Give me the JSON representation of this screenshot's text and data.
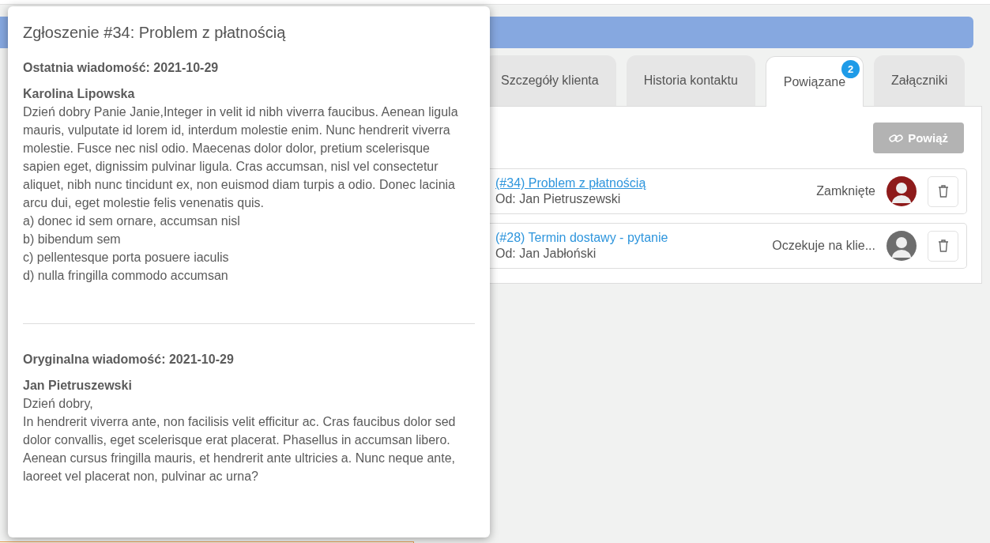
{
  "popover": {
    "title": "Zgłoszenie #34: Problem z płatnością",
    "sections": [
      {
        "heading": "Ostatnia wiadomość: 2021-10-29",
        "author": "Karolina Lipowska",
        "lines": [
          "Dzień dobry Panie Janie,Integer in velit id nibh viverra faucibus. Aenean ligula mauris, vulputate id lorem id, interdum molestie enim. Nunc hendrerit viverra molestie. Fusce nec nisl odio. Maecenas dolor dolor, pretium scelerisque sapien eget, dignissim pulvinar ligula. Cras accumsan, nisl vel consectetur aliquet, nibh nunc tincidunt ex, non euismod diam turpis a odio. Donec lacinia arcu dui, eget molestie felis venenatis quis.",
          "a) donec id sem ornare, accumsan nisl",
          "b) bibendum sem",
          "c) pellentesque porta posuere iaculis",
          "d) nulla fringilla commodo accumsan"
        ]
      },
      {
        "heading": "Oryginalna wiadomość: 2021-10-29",
        "author": "Jan Pietruszewski",
        "lines": [
          "Dzień dobry,",
          "In hendrerit viverra ante, non facilisis velit efficitur ac. Cras faucibus dolor sed dolor convallis, eget scelerisque erat placerat. Phasellus in accumsan libero.",
          "Aenean cursus fringilla mauris, et hendrerit ante ultricies a. Nunc neque ante, laoreet vel placerat non, pulvinar ac urna?"
        ]
      }
    ]
  },
  "tabs": [
    {
      "label": "Szczegóły klienta",
      "selected": false
    },
    {
      "label": "Historia kontaktu",
      "selected": false
    },
    {
      "label": "Powiązane",
      "selected": true,
      "badge": "2"
    },
    {
      "label": "Załączniki",
      "selected": false
    }
  ],
  "link_button": "Powiąż",
  "related": [
    {
      "title": "(#34) Problem z płatnością",
      "from": "Od: Jan Pietruszewski",
      "status": "Zamknięte",
      "color": "#8e1b1b",
      "hovered": true
    },
    {
      "title": "(#28) Termin dostawy - pytanie",
      "from": "Od: Jan Jabłoński",
      "status": "Oczekuje na klie...",
      "color": "#6d6d6d",
      "hovered": false
    }
  ]
}
